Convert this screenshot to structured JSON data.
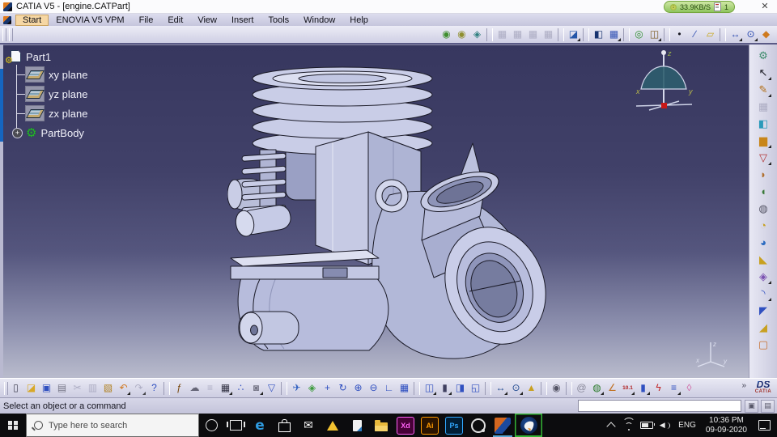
{
  "window": {
    "title": "CATIA V5 - [engine.CATPart]",
    "close_label": "✕"
  },
  "net_widget": {
    "arrow": "↓",
    "speed": "33.9KB/S",
    "count": "1"
  },
  "menubar": {
    "items": [
      {
        "name": "menu-start",
        "label": "Start",
        "active": true
      },
      {
        "name": "menu-enovia",
        "label": "ENOVIA V5 VPM"
      },
      {
        "name": "menu-file",
        "label": "File"
      },
      {
        "name": "menu-edit",
        "label": "Edit"
      },
      {
        "name": "menu-view",
        "label": "View"
      },
      {
        "name": "menu-insert",
        "label": "Insert"
      },
      {
        "name": "menu-tools",
        "label": "Tools"
      },
      {
        "name": "menu-window",
        "label": "Window"
      },
      {
        "name": "menu-help",
        "label": "Help"
      }
    ]
  },
  "toolbar_top": {
    "icons": [
      {
        "name": "enovia-save-icon",
        "glyph": "◉",
        "color": "#3f8f2f"
      },
      {
        "name": "enovia-manage-icon",
        "glyph": "◉",
        "color": "#8f8f2f"
      },
      {
        "name": "enovia-search-icon",
        "glyph": "◈",
        "color": "#2f7f7f"
      },
      {
        "sep": true
      },
      {
        "name": "window-arrange-icon-1",
        "glyph": "▦",
        "disabled": true
      },
      {
        "name": "window-arrange-icon-2",
        "glyph": "▦",
        "disabled": true
      },
      {
        "name": "window-arrange-icon-3",
        "glyph": "▦",
        "disabled": true
      },
      {
        "name": "window-arrange-icon-4",
        "glyph": "▦",
        "disabled": true
      },
      {
        "sep": true
      },
      {
        "name": "catalog-browser-icon",
        "glyph": "◪",
        "color": "#2456a8",
        "dd": true
      },
      {
        "sep": true
      },
      {
        "name": "sketch-plane-icon",
        "glyph": "◧",
        "color": "#16326e"
      },
      {
        "name": "grid-icon",
        "glyph": "▦",
        "color": "#3353b5",
        "dd": true
      },
      {
        "sep": true
      },
      {
        "name": "zoom-area-icon",
        "glyph": "◎",
        "color": "#2f8f2f"
      },
      {
        "name": "view-cube-icon",
        "glyph": "◫",
        "color": "#7a5a20",
        "dd": true
      },
      {
        "sep": true
      },
      {
        "name": "point-icon",
        "glyph": "•",
        "color": "#15151f"
      },
      {
        "name": "line-icon",
        "glyph": "∕",
        "color": "#2a4ab0"
      },
      {
        "name": "plane-icon",
        "glyph": "▱",
        "color": "#c8a81e"
      },
      {
        "sep": true
      },
      {
        "name": "measure-between-icon",
        "glyph": "↔",
        "color": "#2a4ab0",
        "dd": true
      },
      {
        "name": "measure-item-icon",
        "glyph": "⊙",
        "color": "#2a4ab0",
        "dd": true
      },
      {
        "name": "mass-properties-icon",
        "glyph": "◆",
        "color": "#cf7a1f"
      }
    ]
  },
  "tree": {
    "root": {
      "label": "Part1"
    },
    "planes": [
      {
        "name": "tree-item-xy-plane",
        "label": "xy plane"
      },
      {
        "name": "tree-item-yz-plane",
        "label": "yz plane"
      },
      {
        "name": "tree-item-zx-plane",
        "label": "zx plane"
      }
    ],
    "body": {
      "label": "PartBody",
      "expander": "+"
    }
  },
  "viewport": {
    "bg_top": "#37375f",
    "bg_bottom": "#babccd",
    "compass": {
      "x": "x",
      "y": "y",
      "z": "z"
    },
    "triad": {
      "x": "x",
      "y": "y",
      "z": "z"
    }
  },
  "right_toolbar": {
    "icons": [
      {
        "name": "gear-icon",
        "glyph": "⚙",
        "color": "#3a8a6a"
      },
      {
        "sep": true
      },
      {
        "name": "select-pointer-icon",
        "glyph": "↖",
        "color": "#15151f",
        "dd": true
      },
      {
        "sep": true
      },
      {
        "name": "sketcher-icon",
        "glyph": "✎",
        "color": "#b06a10",
        "dd": true
      },
      {
        "sep": true
      },
      {
        "name": "sketch-tools-icon",
        "glyph": "▦",
        "disabled": true
      },
      {
        "name": "workbench-box-icon",
        "glyph": "◧",
        "color": "#2a9aba"
      },
      {
        "sep": true
      },
      {
        "name": "pad-icon",
        "glyph": "▆",
        "color": "#c8861a",
        "dd": true
      },
      {
        "name": "pocket-icon",
        "glyph": "▽",
        "color": "#b03030",
        "dd": true
      },
      {
        "name": "shaft-icon",
        "glyph": "◗",
        "color": "#b07030"
      },
      {
        "name": "groove-icon",
        "glyph": "◖",
        "color": "#3a7a3a"
      },
      {
        "name": "hole-icon",
        "glyph": "◍",
        "color": "#555566"
      },
      {
        "name": "rib-icon",
        "glyph": "◔",
        "color": "#c8a020"
      },
      {
        "name": "slot-icon",
        "glyph": "◕",
        "color": "#2a6ac0"
      },
      {
        "name": "stiffener-icon",
        "glyph": "◣",
        "color": "#c8a020"
      },
      {
        "name": "loft-icon",
        "glyph": "◈",
        "color": "#7a50b0",
        "dd": true
      },
      {
        "sep": true
      },
      {
        "name": "fillet-icon",
        "glyph": "◝",
        "color": "#3050c0",
        "dd": true
      },
      {
        "name": "chamfer-icon",
        "glyph": "◤",
        "color": "#3050c0"
      },
      {
        "name": "draft-icon",
        "glyph": "◢",
        "color": "#c8a020"
      },
      {
        "name": "shell-icon",
        "glyph": "▢",
        "color": "#c87030"
      }
    ]
  },
  "toolbar_bottom": {
    "icons": [
      {
        "name": "new-file-icon",
        "glyph": "▯",
        "color": "#445"
      },
      {
        "name": "open-folder-icon",
        "glyph": "◪",
        "color": "#d8a828"
      },
      {
        "name": "save-icon",
        "glyph": "▣",
        "color": "#3050c0"
      },
      {
        "name": "print-icon",
        "glyph": "▤",
        "color": "#778"
      },
      {
        "name": "cut-icon",
        "glyph": "✂",
        "disabled": true
      },
      {
        "name": "copy-icon",
        "glyph": "▥",
        "disabled": true
      },
      {
        "name": "paste-icon",
        "glyph": "▧",
        "color": "#b08020"
      },
      {
        "name": "undo-icon",
        "glyph": "↶",
        "color": "#d07820",
        "dd": true
      },
      {
        "name": "redo-icon",
        "glyph": "↷",
        "disabled": true,
        "dd": true
      },
      {
        "name": "help-icon",
        "glyph": "?",
        "color": "#3050c0"
      },
      {
        "sep": true
      },
      {
        "name": "fx-formula-icon",
        "glyph": "ƒ",
        "color": "#7a4a10"
      },
      {
        "name": "comment-icon",
        "glyph": "☁",
        "color": "#667"
      },
      {
        "name": "knowledge-icon",
        "glyph": "≡",
        "disabled": true
      },
      {
        "name": "calculator-icon",
        "glyph": "▦",
        "color": "#333344",
        "dd": true
      },
      {
        "name": "structure-tree-icon",
        "glyph": "∴",
        "color": "#3050c0"
      },
      {
        "name": "lock-icon",
        "glyph": "◙",
        "color": "#777788",
        "dd": true
      },
      {
        "name": "filter-icon",
        "glyph": "▽",
        "color": "#3050c0"
      },
      {
        "sep": true
      },
      {
        "name": "fly-mode-icon",
        "glyph": "✈",
        "color": "#3060c0"
      },
      {
        "name": "fit-all-icon",
        "glyph": "◈",
        "color": "#3a9a3a"
      },
      {
        "name": "pan-icon",
        "glyph": "+",
        "color": "#3050c0"
      },
      {
        "name": "rotate-icon",
        "glyph": "↻",
        "color": "#3050c0"
      },
      {
        "name": "zoom-in-icon",
        "glyph": "⊕",
        "color": "#3050c0"
      },
      {
        "name": "zoom-out-icon",
        "glyph": "⊖",
        "color": "#3050c0"
      },
      {
        "name": "normal-view-icon",
        "glyph": "∟",
        "color": "#3050c0"
      },
      {
        "name": "multi-view-icon",
        "glyph": "▦",
        "color": "#3050c0"
      },
      {
        "sep": true
      },
      {
        "name": "iso-view-icon",
        "glyph": "◫",
        "color": "#3050c0",
        "dd": true
      },
      {
        "name": "shading-icon",
        "glyph": "▮",
        "color": "#404060",
        "dd": true
      },
      {
        "name": "hide-show-icon",
        "glyph": "◨",
        "color": "#3050c0"
      },
      {
        "name": "swap-space-icon",
        "glyph": "◱",
        "color": "#3050c0"
      },
      {
        "sep": true
      },
      {
        "name": "measure-between-icon",
        "glyph": "↔",
        "color": "#204a90",
        "dd": true
      },
      {
        "name": "measure-item-icon",
        "glyph": "⊙",
        "color": "#204a90",
        "dd": true
      },
      {
        "name": "mass-measure-icon",
        "glyph": "▲",
        "color": "#c8a020"
      },
      {
        "sep": true
      },
      {
        "name": "camera-icon",
        "glyph": "◉",
        "color": "#555566"
      },
      {
        "sep": true
      },
      {
        "name": "spiral-icon",
        "glyph": "@",
        "color": "#888899"
      },
      {
        "name": "globe-icon",
        "glyph": "◍",
        "color": "#2a7a2a",
        "dd": true
      },
      {
        "name": "axis-system-icon",
        "glyph": "∠",
        "color": "#c07020"
      },
      {
        "name": "snap-ratio-icon",
        "glyph": "10.1",
        "small": true,
        "dd": true
      },
      {
        "name": "cylinder-icon",
        "glyph": "▮",
        "color": "#3050c0",
        "dd": true
      },
      {
        "name": "knowledge-bolt-icon",
        "glyph": "ϟ",
        "color": "#c02020"
      },
      {
        "name": "list-edit-icon",
        "glyph": "≡",
        "color": "#3050c0",
        "dd": true
      },
      {
        "name": "eraser-icon",
        "glyph": "◊",
        "color": "#d060a0"
      }
    ],
    "overflow": "»",
    "logo_ds": "DS",
    "logo_catia": "CATIA"
  },
  "status": {
    "message": "Select an object or a command",
    "buttons": [
      {
        "name": "status-doc-button",
        "glyph": "▣"
      },
      {
        "name": "status-window-button",
        "glyph": "▤"
      }
    ]
  },
  "taskbar": {
    "search_placeholder": "Type here to search",
    "apps": {
      "edge": "e",
      "xd": "Xd",
      "ai": "Ai",
      "ps": "Ps"
    },
    "tray": {
      "lang": "ENG",
      "time": "10:36 PM",
      "date": "09-09-2020"
    }
  },
  "colors": {
    "viewport_gradient_top": "#37375f",
    "viewport_gradient_bottom": "#babccd",
    "toolbar_bg": "#cfcfe4",
    "menu_highlight": "#f6d7a4",
    "net_widget_green": "#8fc45f",
    "taskbar_bg": "#0c0c0e",
    "active_app_green": "#35b435",
    "active_app_blue": "#5aa9d6",
    "model_fill": "#c6cae4",
    "compass_dome": "#2d5d6e"
  }
}
